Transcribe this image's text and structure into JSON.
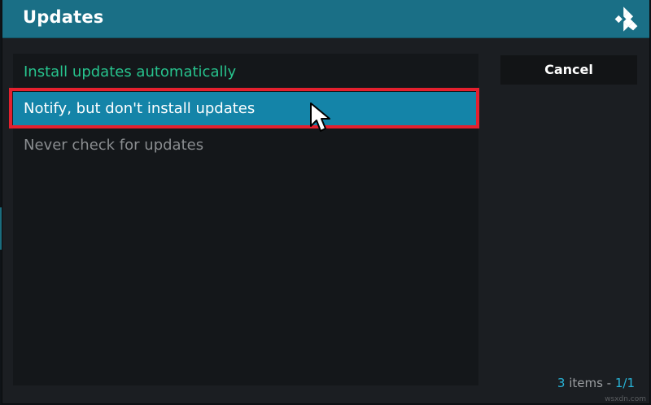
{
  "dialog": {
    "title": "Updates",
    "logo_icon": "kodi-logo-icon"
  },
  "options": [
    {
      "label": "Install updates automatically",
      "state": "selected",
      "color": "#27c48e"
    },
    {
      "label": "Notify, but don't install updates",
      "state": "focused",
      "color": "#ffffff"
    },
    {
      "label": "Never check for updates",
      "state": "normal",
      "color": "#8a8d90"
    }
  ],
  "cancel_label": "Cancel",
  "footer": {
    "count": "3",
    "items_word": " items - ",
    "page": "1/1"
  },
  "watermark": "wsxdn.com",
  "colors": {
    "titlebar": "#1a6f86",
    "focus": "#1484a8",
    "highlight_box": "#e4202e",
    "accent": "#28b4d8"
  }
}
